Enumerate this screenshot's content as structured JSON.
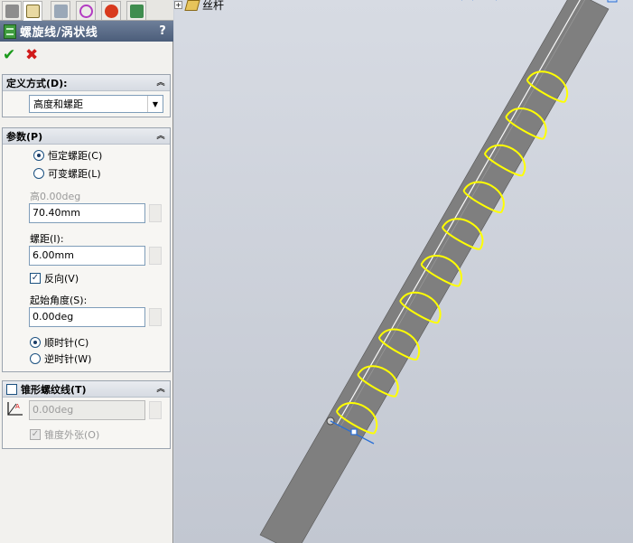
{
  "feature": {
    "title": "螺旋线/涡状线",
    "help": "?"
  },
  "toolbar": {
    "ok": "✔",
    "cancel": "✖"
  },
  "tabs": [
    {
      "name": "feature-manager-icon"
    },
    {
      "name": "property-manager-icon"
    },
    {
      "name": "configuration-manager-icon"
    },
    {
      "name": "dimxpert-icon"
    },
    {
      "name": "appearance-icon"
    },
    {
      "name": "display-manager-icon"
    }
  ],
  "definition": {
    "header": "定义方式(D):",
    "selected": "高度和螺距"
  },
  "params": {
    "header": "参数(P)",
    "constant_pitch": "恒定螺距(C)",
    "variable_pitch": "可变螺距(L)",
    "height_label": "高0.00deg",
    "height_value": "70.40mm",
    "pitch_label": "螺距(I):",
    "pitch_value": "6.00mm",
    "reverse_label": "反向(V)",
    "start_angle_label": "起始角度(S):",
    "start_angle_value": "0.00deg",
    "clockwise": "顺时针(C)",
    "counterclockwise": "逆时针(W)"
  },
  "taper": {
    "header": "锥形螺纹线(T)",
    "angle_value": "0.00deg",
    "outward_label": "锥度外张(O)"
  },
  "tree": {
    "part_name": "丝杆"
  },
  "colors": {
    "helix": "#ffff00",
    "selection": "#2a6fd6"
  }
}
